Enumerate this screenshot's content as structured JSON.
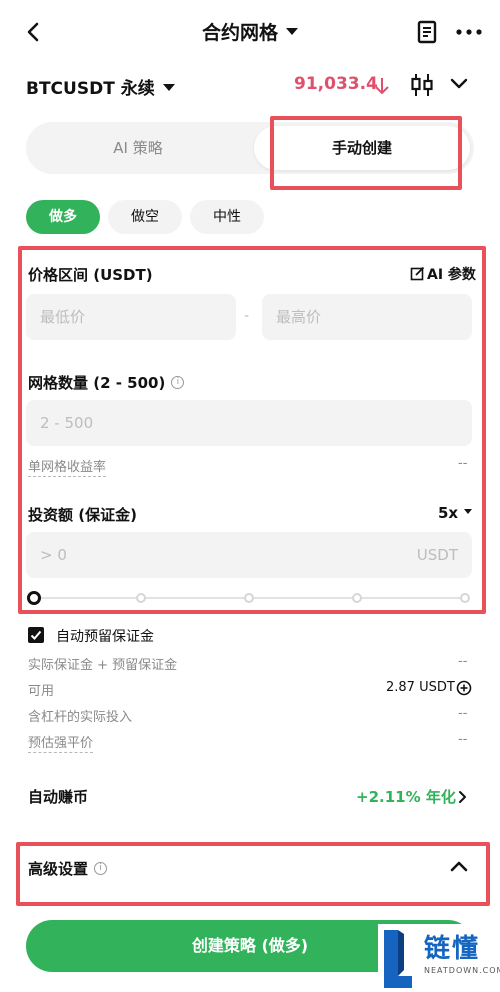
{
  "header": {
    "title": "合约网格"
  },
  "pair": {
    "name": "BTCUSDT 永续",
    "price": "91,033.4"
  },
  "mode": {
    "ai_label": "AI 策略",
    "manual_label": "手动创建"
  },
  "direction": {
    "long": "做多",
    "short": "做空",
    "neutral": "中性"
  },
  "price_range": {
    "label": "价格区间 (USDT)",
    "ai_params": "AI 参数",
    "min_placeholder": "最低价",
    "separator": "-",
    "max_placeholder": "最高价"
  },
  "grid_count": {
    "label": "网格数量 (2 - 500)",
    "placeholder": "2 - 500",
    "per_grid_label": "单网格收益率",
    "per_grid_value": "--"
  },
  "investment": {
    "label": "投资额 (保证金)",
    "leverage": "5x",
    "placeholder": "> 0",
    "unit": "USDT"
  },
  "slider": {
    "value": 0
  },
  "margin": {
    "auto_reserve_label": "自动预留保证金",
    "auto_reserve_checked": true,
    "actual_label": "实际保证金 + 预留保证金",
    "actual_value": "--",
    "available_label": "可用",
    "available_value": "2.87 USDT",
    "leverage_invest_label": "含杠杆的实际投入",
    "leverage_invest_value": "--",
    "liq_label": "预估强平价",
    "liq_value": "--"
  },
  "auto_earn": {
    "label": "自动赚币",
    "value": "+2.11% 年化"
  },
  "advanced": {
    "label": "高级设置"
  },
  "submit": {
    "label": "创建策略 (做多)"
  },
  "watermark": {
    "brand": "链懂",
    "domain": "NEATDOWN.COM"
  },
  "colors": {
    "accent_green": "#32b25a",
    "price_red": "#e0506d",
    "highlight_red": "#e8515a"
  }
}
